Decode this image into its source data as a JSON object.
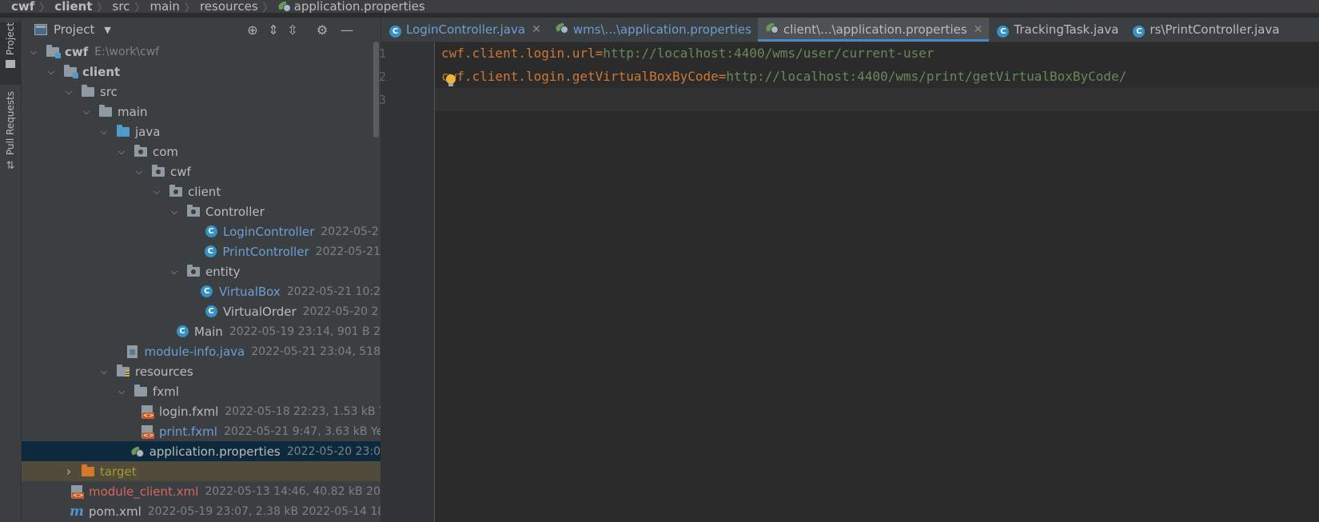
{
  "breadcrumb": [
    "cwf",
    "client",
    "src",
    "main",
    "resources",
    "application.properties"
  ],
  "tool_stripe": {
    "project_label": "Project",
    "pull_requests_label": "Pull Requests"
  },
  "project_panel": {
    "title": "Project"
  },
  "tree": [
    {
      "name": "cwf",
      "meta": "E:\\work\\cwf",
      "icon": "module-folder-icon",
      "depth": 0,
      "expanded": true,
      "bold": true
    },
    {
      "name": "client",
      "meta": "",
      "icon": "module-folder-icon",
      "depth": 1,
      "expanded": true,
      "bold": true
    },
    {
      "name": "src",
      "meta": "",
      "icon": "folder-icon",
      "depth": 2,
      "expanded": true
    },
    {
      "name": "main",
      "meta": "",
      "icon": "folder-icon",
      "depth": 3,
      "expanded": true
    },
    {
      "name": "java",
      "meta": "",
      "icon": "source-folder-icon",
      "depth": 4,
      "expanded": true
    },
    {
      "name": "com",
      "meta": "",
      "icon": "package-icon",
      "depth": 5,
      "expanded": true
    },
    {
      "name": "cwf",
      "meta": "",
      "icon": "package-icon",
      "depth": 6,
      "expanded": true
    },
    {
      "name": "client",
      "meta": "",
      "icon": "package-icon",
      "depth": 7,
      "expanded": true
    },
    {
      "name": "Controller",
      "meta": "",
      "icon": "package-icon",
      "depth": 8,
      "expanded": true
    },
    {
      "name": "LoginController",
      "meta": "2022-05-2",
      "icon": "class-icon",
      "depth": 9,
      "color": "blue"
    },
    {
      "name": "PrintController",
      "meta": "2022-05-21",
      "icon": "class-icon",
      "depth": 9,
      "color": "blue"
    },
    {
      "name": "entity",
      "meta": "",
      "icon": "package-icon",
      "depth": 8,
      "expanded": true
    },
    {
      "name": "VirtualBox",
      "meta": "2022-05-21 10:2",
      "icon": "class-icon",
      "depth": 9,
      "color": "blue"
    },
    {
      "name": "VirtualOrder",
      "meta": "2022-05-20 2",
      "icon": "class-icon",
      "depth": 9
    },
    {
      "name": "Main",
      "meta": "2022-05-19 23:14, 901 B 2",
      "icon": "main-class-icon",
      "depth": 8
    },
    {
      "name": "module-info.java",
      "meta": "2022-05-21 23:04, 518",
      "icon": "java-file-icon",
      "depth": 5,
      "color": "blue"
    },
    {
      "name": "resources",
      "meta": "",
      "icon": "resources-folder-icon",
      "depth": 4,
      "expanded": true
    },
    {
      "name": "fxml",
      "meta": "",
      "icon": "folder-icon",
      "depth": 5,
      "expanded": true
    },
    {
      "name": "login.fxml",
      "meta": "2022-05-18 22:23, 1.53 kB Y",
      "icon": "fxml-file-icon",
      "depth": 6
    },
    {
      "name": "print.fxml",
      "meta": "2022-05-21 9:47, 3.63 kB Ye",
      "icon": "fxml-file-icon",
      "depth": 6,
      "color": "blue"
    },
    {
      "name": "application.properties",
      "meta": "2022-05-20 23:0",
      "icon": "properties-file-icon",
      "depth": 5,
      "selected": true
    },
    {
      "name": "target",
      "meta": "",
      "icon": "excluded-folder-icon",
      "depth": 2,
      "collapsed": true,
      "color": "orange",
      "excluded": true
    },
    {
      "name": "module_client.xml",
      "meta": "2022-05-13 14:46, 40.82 kB 202",
      "icon": "xml-file-icon",
      "depth": 2,
      "color": "red"
    },
    {
      "name": "pom.xml",
      "meta": "2022-05-19 23:07, 2.38 kB 2022-05-14 18:2",
      "icon": "maven-icon",
      "depth": 2
    }
  ],
  "tabs": [
    {
      "label": "LoginController.java",
      "icon": "class-icon",
      "closable": true
    },
    {
      "label": "wms\\...\\application.properties",
      "icon": "properties-file-icon",
      "closable": false
    },
    {
      "label": "client\\...\\application.properties",
      "icon": "properties-file-icon",
      "closable": true,
      "active": true
    },
    {
      "label": "TrackingTask.java",
      "icon": "class-icon",
      "closable": false,
      "plain": true
    },
    {
      "label": "rs\\PrintController.java",
      "icon": "class-icon",
      "closable": false,
      "plain": true
    }
  ],
  "editor": {
    "line_numbers": [
      "1",
      "2",
      "3"
    ],
    "lines": [
      {
        "key": "cwf.client.login.url",
        "sep": "=",
        "value": "http://localhost:4400/wms/user/current-user"
      },
      {
        "key": "cwf.client.login.getVirtualBoxByCode",
        "sep": "=",
        "value": "http://localhost:4400/wms/print/getVirtualBoxByCode/"
      },
      {
        "key": "",
        "sep": "",
        "value": ""
      }
    ]
  },
  "colors": {
    "accent": "#4a88c7",
    "selection": "#0d293e",
    "keyword": "#cc7832",
    "string": "#6a8759"
  }
}
